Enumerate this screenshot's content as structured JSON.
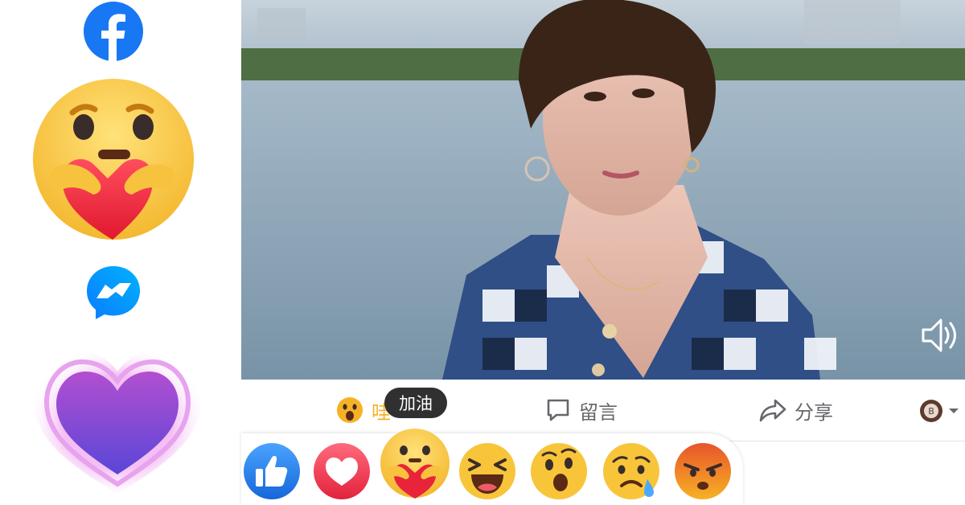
{
  "tooltip": {
    "text": "加油"
  },
  "actions": {
    "wow_label": "哇",
    "comment_label": "留言",
    "share_label": "分享"
  },
  "avatar": {
    "initial": "B"
  },
  "reactions": [
    {
      "name": "like"
    },
    {
      "name": "love"
    },
    {
      "name": "care"
    },
    {
      "name": "haha"
    },
    {
      "name": "wow"
    },
    {
      "name": "sad"
    },
    {
      "name": "angry"
    }
  ],
  "colors": {
    "facebook_blue": "#1877f2",
    "wow_yellow": "#f7b125",
    "tooltip_bg": "#303030",
    "action_grey": "#65676b"
  },
  "icons": [
    "facebook-logo-icon",
    "care-emoji-icon",
    "messenger-logo-icon",
    "heart-icon",
    "volume-icon",
    "comment-icon",
    "share-icon",
    "chevron-down-icon"
  ]
}
